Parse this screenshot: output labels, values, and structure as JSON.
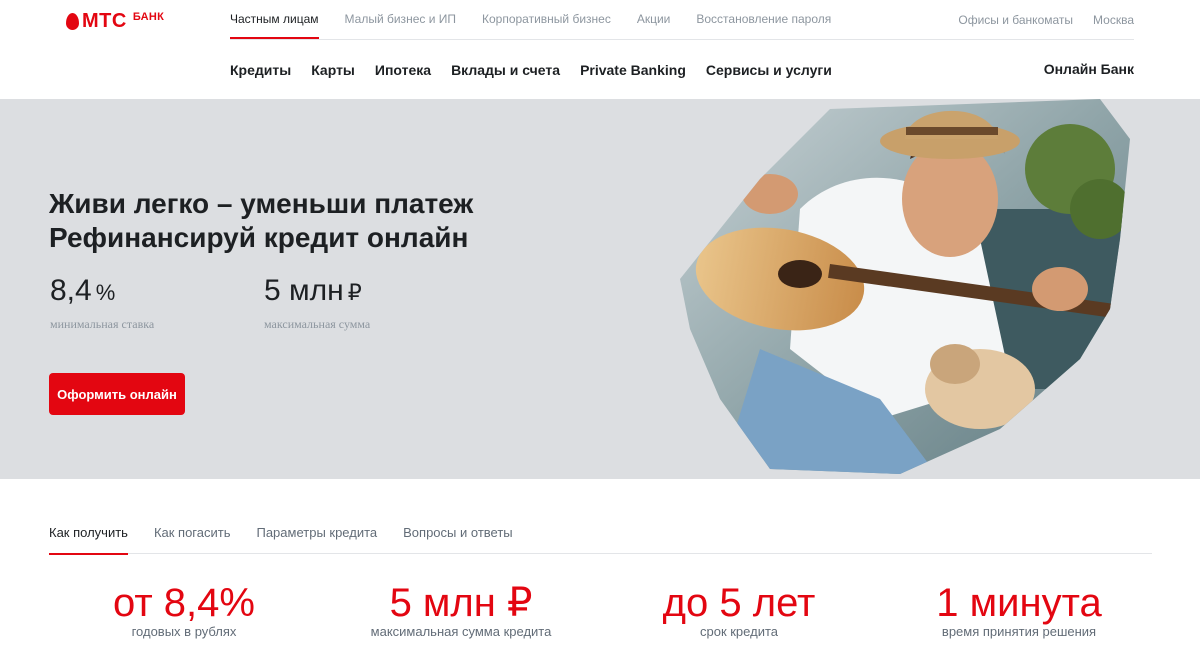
{
  "logo": {
    "brand": "МТС",
    "sub": "БАНК"
  },
  "top_nav": [
    "Частным лицам",
    "Малый бизнес и ИП",
    "Корпоративный бизнес",
    "Акции",
    "Восстановление пароля"
  ],
  "top_right": [
    "Офисы и банкоматы",
    "Москва"
  ],
  "main_nav": [
    "Кредиты",
    "Карты",
    "Ипотека",
    "Вклады и счета",
    "Private Banking",
    "Сервисы и услуги"
  ],
  "online_bank": "Онлайн Банк",
  "hero": {
    "title_line1": "Живи легко – уменьши платеж",
    "title_line2": "Рефинансируй кредит онлайн",
    "stat1": {
      "value": "8,4",
      "unit": "%",
      "label": "минимальная ставка"
    },
    "stat2": {
      "value": "5 млн",
      "unit": "₽",
      "label": "максимальная сумма"
    },
    "button": "Оформить онлайн"
  },
  "tabs": [
    "Как получить",
    "Как погасить",
    "Параметры кредита",
    "Вопросы и ответы"
  ],
  "features": [
    {
      "value": "от 8,4%",
      "label": "годовых в рублях"
    },
    {
      "value": "5 млн ₽",
      "label": "максимальная сумма кредита"
    },
    {
      "value": "до 5 лет",
      "label": "срок кредита"
    },
    {
      "value": "1 минута",
      "label": "время принятия решения"
    }
  ],
  "colors": {
    "accent": "#e30611",
    "hero_bg": "#dcdee1",
    "text": "#1d2023",
    "muted": "#8d969f"
  }
}
